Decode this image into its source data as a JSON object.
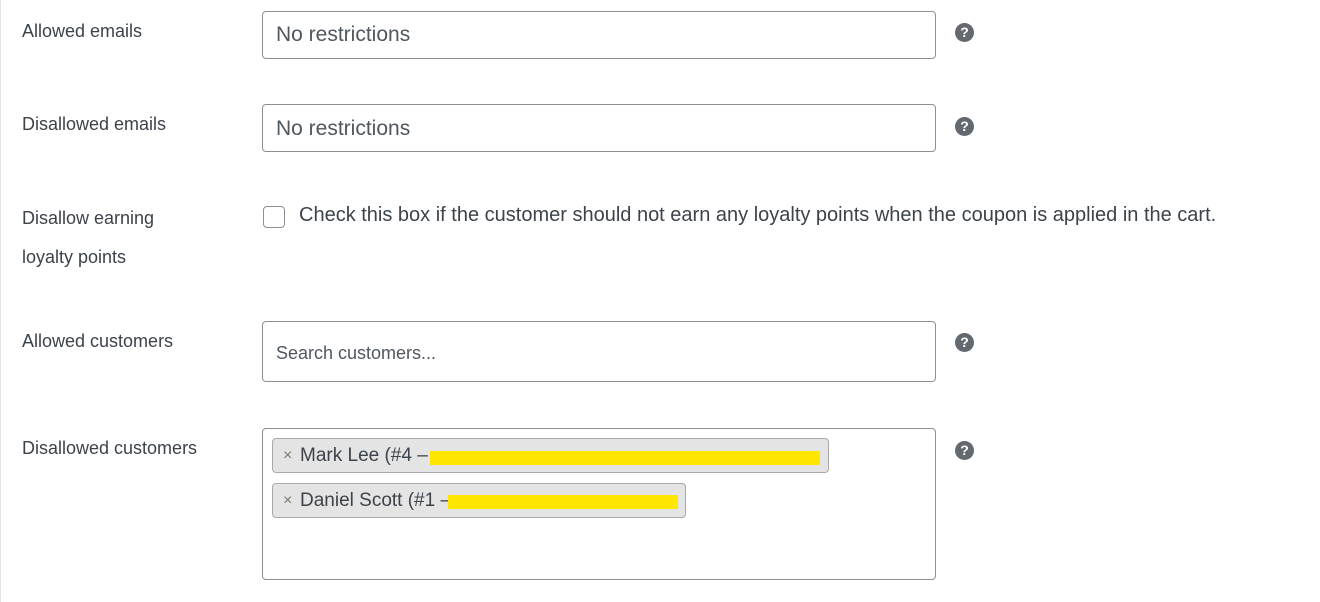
{
  "rows": {
    "allowed_emails": {
      "label": "Allowed emails",
      "placeholder": "No restrictions"
    },
    "disallowed_emails": {
      "label": "Disallowed emails",
      "placeholder": "No restrictions"
    },
    "disallow_loyalty": {
      "label_line1": "Disallow earning",
      "label_line2": "loyalty points",
      "checkbox_checked": false,
      "description": "Check this box if the customer should not earn any loyalty points when the coupon is applied in the cart."
    },
    "allowed_customers": {
      "label": "Allowed customers",
      "placeholder": "Search customers..."
    },
    "disallowed_customers": {
      "label": "Disallowed customers",
      "chips": [
        {
          "remove": "×",
          "text": "Mark Lee (#4 –"
        },
        {
          "remove": "×",
          "text": "Daniel Scott (#1 –"
        }
      ]
    }
  },
  "help_icon_glyph": "?",
  "colors": {
    "redaction": "#ffe600",
    "help_icon": "#646970",
    "border": "#8c8f94"
  }
}
